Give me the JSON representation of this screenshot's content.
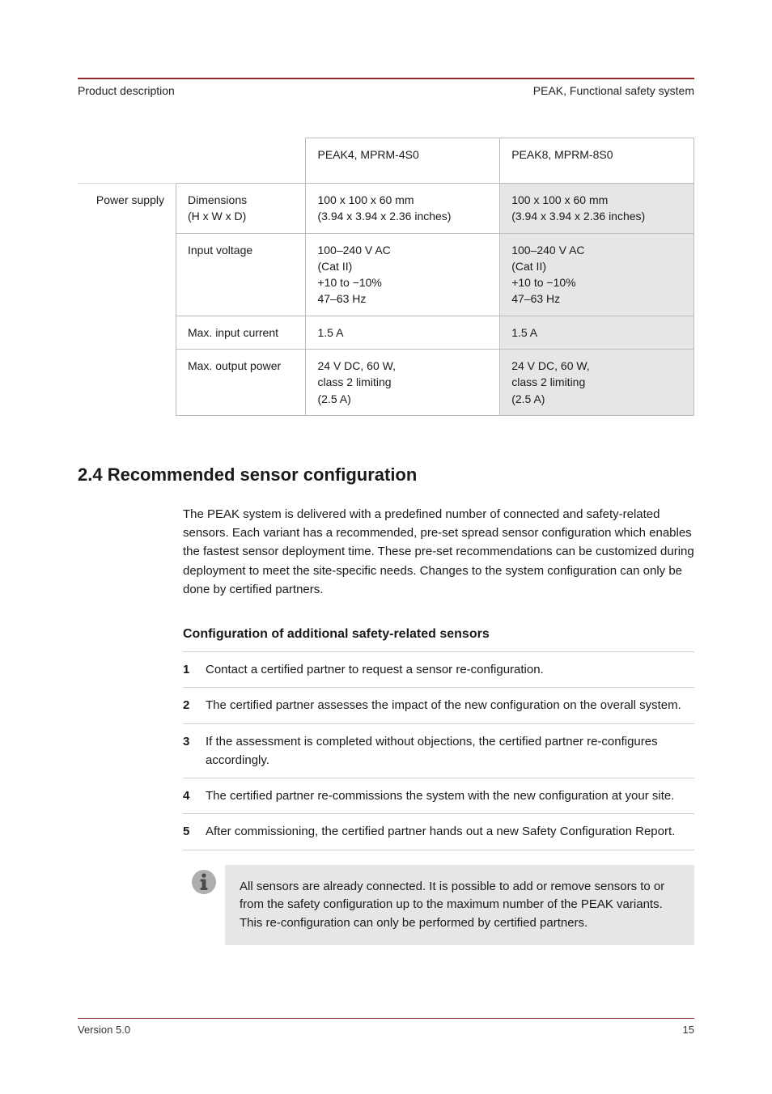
{
  "header": {
    "left": "Product description",
    "right": "PEAK, Functional safety system"
  },
  "table": {
    "cols": [
      "PEAK4, MPRM-4S0",
      "PEAK8, MPRM-8S0"
    ],
    "rowgroup": "Power supply",
    "rows": [
      {
        "sub": "Dimensions\n(H x W x D)",
        "a": "100 x 100 x 60 mm\n(3.94 x 3.94 x 2.36 inches)",
        "b": "100 x 100 x 60 mm\n(3.94 x 3.94 x 2.36 inches)"
      },
      {
        "sub": "Input voltage",
        "a": "100–240 V AC\n(Cat II)\n+10 to −10%\n47–63 Hz",
        "b": "100–240 V AC\n(Cat II)\n+10 to −10%\n47–63 Hz"
      },
      {
        "sub": "Max. input current",
        "a": "1.5 A",
        "b": "1.5 A"
      },
      {
        "sub": "Max. output power",
        "a": "24 V DC, 60 W,\nclass 2 limiting\n(2.5 A)",
        "b": "24 V DC, 60 W,\nclass 2 limiting\n(2.5 A)"
      }
    ]
  },
  "section": {
    "heading": "2.4  Recommended sensor configuration",
    "para1": "The PEAK system is delivered with a predefined number of connected and safety-related sensors. Each variant has a recommended, pre-set spread sensor configuration which enables the fastest sensor deployment time. These pre-set recommendations can be customized during deployment to meet the site-specific needs. Changes to the system configuration can only be done by certified partners."
  },
  "procedure": {
    "heading": "Configuration of additional safety-related sensors",
    "steps": [
      {
        "n": "1",
        "t": "Contact a certified partner to request a sensor re-configuration."
      },
      {
        "n": "2",
        "t": "The certified partner assesses the impact of the new configuration on the overall system."
      },
      {
        "n": "3",
        "t": "If the assessment is completed without objections, the certified partner re-configures accordingly."
      },
      {
        "n": "4",
        "t": "The certified partner re-commissions the system with the new configuration at your site."
      },
      {
        "n": "5",
        "t": "After commissioning, the certified partner hands out a new Safety Configuration Report."
      }
    ]
  },
  "note": {
    "text": "All sensors are already connected. It is possible to add or remove sensors to or from the safety configuration up to the maximum number of the PEAK variants. This re-configuration can only be performed by certified partners."
  },
  "footer": {
    "left": "Version 5.0",
    "right": "15"
  }
}
